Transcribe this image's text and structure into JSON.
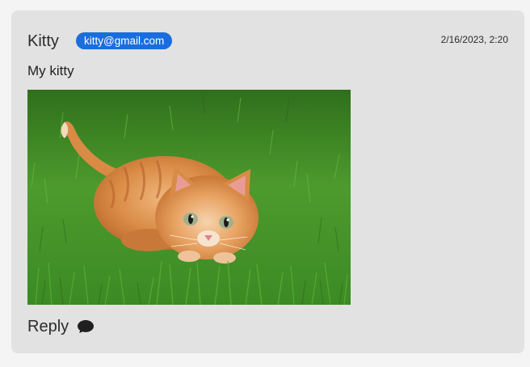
{
  "post": {
    "author": "Kitty",
    "email": "kitty@gmail.com",
    "timestamp": "2/16/2023, 2:20",
    "message": "My kitty",
    "image": {
      "subject": "orange tabby cat crouching on green grass",
      "icon_name": "photo-image"
    },
    "reply_label": "Reply",
    "reply_icon": "speech-bubble-icon"
  },
  "colors": {
    "page_background": "#f3f4f3",
    "card_background": "#e2e2e2",
    "badge_background": "#1a6dde",
    "badge_text": "#ffffff",
    "text": "#2b2b2b"
  }
}
